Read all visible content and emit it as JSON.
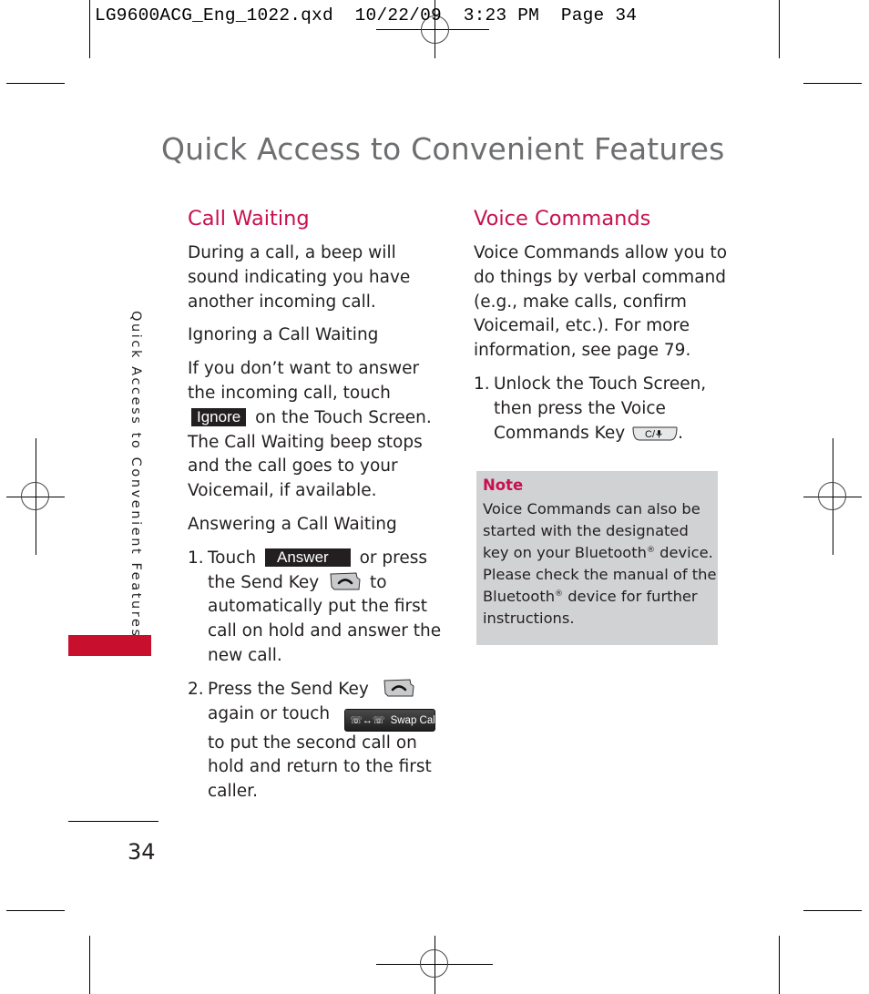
{
  "slug": {
    "filename": "LG9600ACG_Eng_1022.qxd",
    "date": "10/22/09",
    "time": "3:23 PM",
    "page_label": "Page 34"
  },
  "page_title": "Quick Access to Convenient Features",
  "side_tab": {
    "label": "Quick Access to Convenient Features",
    "accent_color": "#c8102e"
  },
  "call_waiting": {
    "title": "Call Waiting",
    "intro": "During a call, a beep will sound indicating you have another incoming call.",
    "ignoring": {
      "heading": "Ignoring a Call Waiting",
      "text_before": "If you don’t want to answer the incoming call, touch",
      "button": "Ignore",
      "text_after": "on the Touch Screen. The Call Waiting beep stops and the call goes to your Voicemail, if available."
    },
    "answering": {
      "heading": "Answering a Call Waiting",
      "steps": [
        {
          "num": "1.",
          "text_a": "Touch",
          "button": "Answer",
          "text_b": "or press the Send Key",
          "icon": "send-key-icon",
          "text_c": "to automatically put the first call on hold and answer the new call."
        },
        {
          "num": "2.",
          "text_a": "Press the Send Key",
          "icon": "send-key-icon",
          "text_b": "again or touch",
          "button": "Swap Calls",
          "text_c": "to put the second call on hold and return to the first caller."
        }
      ]
    }
  },
  "voice_commands": {
    "title": "Voice Commands",
    "intro": "Voice Commands allow you to do things by verbal command (e.g., make calls, confirm Voicemail, etc.). For more information, see page 79.",
    "steps": [
      {
        "num": "1.",
        "text": "Unlock the Touch Screen, then press the Voice Commands Key",
        "key_label": "C/🎙",
        "end": "."
      }
    ],
    "note": {
      "title": "Note",
      "text_a": "Voice Commands can also be started with the designated key on your Bluetooth",
      "reg": "®",
      "text_b": " device. Please check the manual of the Bluetooth",
      "text_c": " device for further instructions."
    }
  },
  "page_number": "34",
  "colors": {
    "heading_accent": "#c8104e",
    "title_gray": "#6d6e70",
    "note_bg": "#d1d2d4"
  }
}
